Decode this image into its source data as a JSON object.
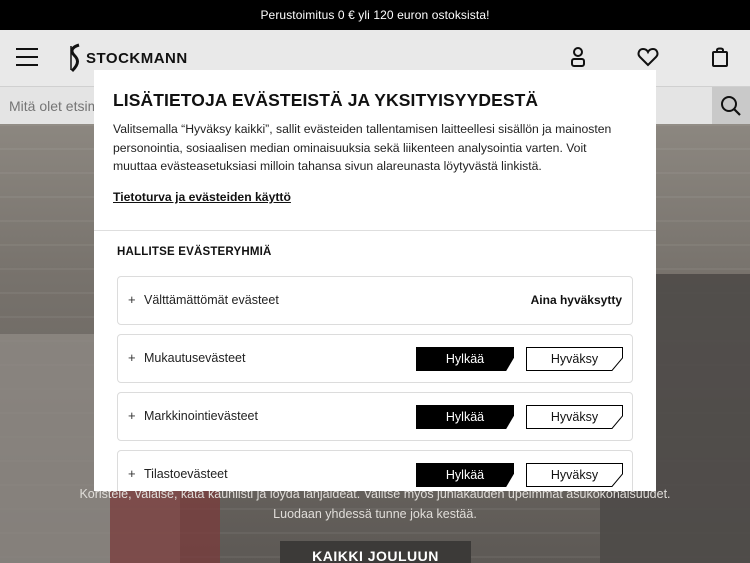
{
  "promo": {
    "text": "Perustoimitus 0 € yli 120 euron ostoksista!"
  },
  "header": {
    "logo_text": "STOCKMANN",
    "icons": [
      "menu-icon",
      "user-icon",
      "heart-icon",
      "bag-icon"
    ]
  },
  "search": {
    "placeholder": "Mitä olet etsimässä?"
  },
  "hero": {
    "text_line1": "Koristele, valaise, kata kauniisti ja löydä lahjaideat. Valitse myös juhlakauden upeimmat asukokonaisuudet.",
    "text_line2": "Luodaan yhdessä tunne joka kestää.",
    "cta_label": "KAIKKI JOULUUN"
  },
  "cookie_modal": {
    "title": "LISÄTIETOJA EVÄSTEISTÄ JA YKSITYISYYDESTÄ",
    "description": "Valitsemalla “Hyväksy kaikki”, sallit evästeiden tallentamisen laitteellesi sisällön ja mainosten personointia, sosiaalisen median ominaisuuksia sekä liikenteen analysointia varten. Voit muuttaa evästeasetuksiasi milloin tahansa sivun alareunasta löytyvästä linkistä.",
    "privacy_link": "Tietoturva ja evästeiden käyttö",
    "section_title": "HALLITSE EVÄSTERYHMIÄ",
    "categories": [
      {
        "label": "Välttämättömät evästeet",
        "status": "Aina hyväksytty"
      },
      {
        "label": "Mukautusevästeet",
        "reject": "Hylkää",
        "accept": "Hyväksy"
      },
      {
        "label": "Markkinointievästeet",
        "reject": "Hylkää",
        "accept": "Hyväksy"
      },
      {
        "label": "Tilastoevästeet",
        "reject": "Hylkää",
        "accept": "Hyväksy"
      }
    ],
    "expand_glyph": "+"
  },
  "colors": {
    "promo_bg": "#000000",
    "header_bg": "#e9e9e9",
    "reject_bg": "#000000",
    "accept_border": "#000000"
  }
}
